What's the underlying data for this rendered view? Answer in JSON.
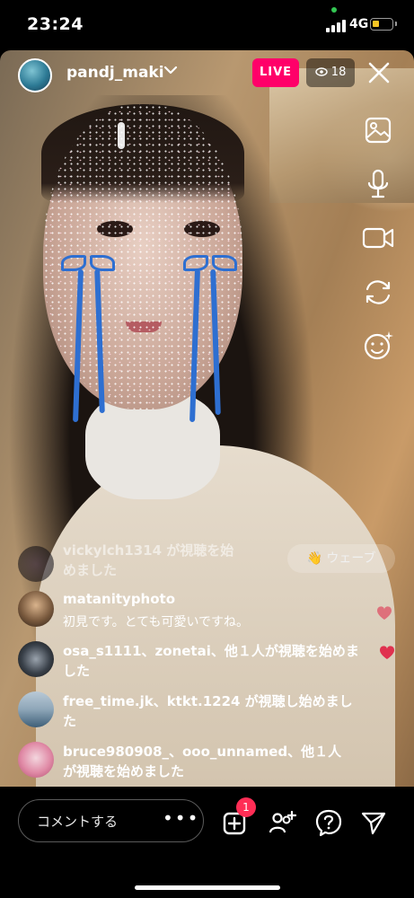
{
  "status": {
    "time": "23:24",
    "network": "4G"
  },
  "host": {
    "username": "pandj_maki"
  },
  "live": {
    "badge": "LIVE",
    "viewer_count": "18"
  },
  "comments": [
    {
      "text": "vickylch1314 が視聴を始めました",
      "line1": "vickylch1314 が視聴を始",
      "line2": "めました"
    },
    {
      "user": "matanityphoto",
      "text": "初見です。とても可愛いですね。"
    },
    {
      "line1": "osa_s1111、zonetai、他１人が視聴を始めま",
      "line2": "した"
    },
    {
      "line1": "free_time.jk、ktkt.1224 が視聴し始めまし",
      "line2": "た"
    },
    {
      "line1": "bruce980908_、ooo_unnamed、他１人",
      "line2": "が視聴を始めました"
    }
  ],
  "wave_button": "👋 ウェーブ",
  "bottom": {
    "comment_placeholder": "コメントする",
    "more": "•••",
    "add_badge": "1"
  },
  "colors": {
    "live": "#ff0069",
    "tear_ribbon": "#2e6fd1",
    "heart": "#e0314f",
    "notification": "#ff2d55"
  },
  "icons": [
    "photo-icon",
    "microphone-icon",
    "video-camera-icon",
    "switch-camera-icon",
    "effects-icon",
    "close-icon",
    "eye-icon",
    "add-icon",
    "invite-icon",
    "question-icon",
    "send-icon"
  ]
}
